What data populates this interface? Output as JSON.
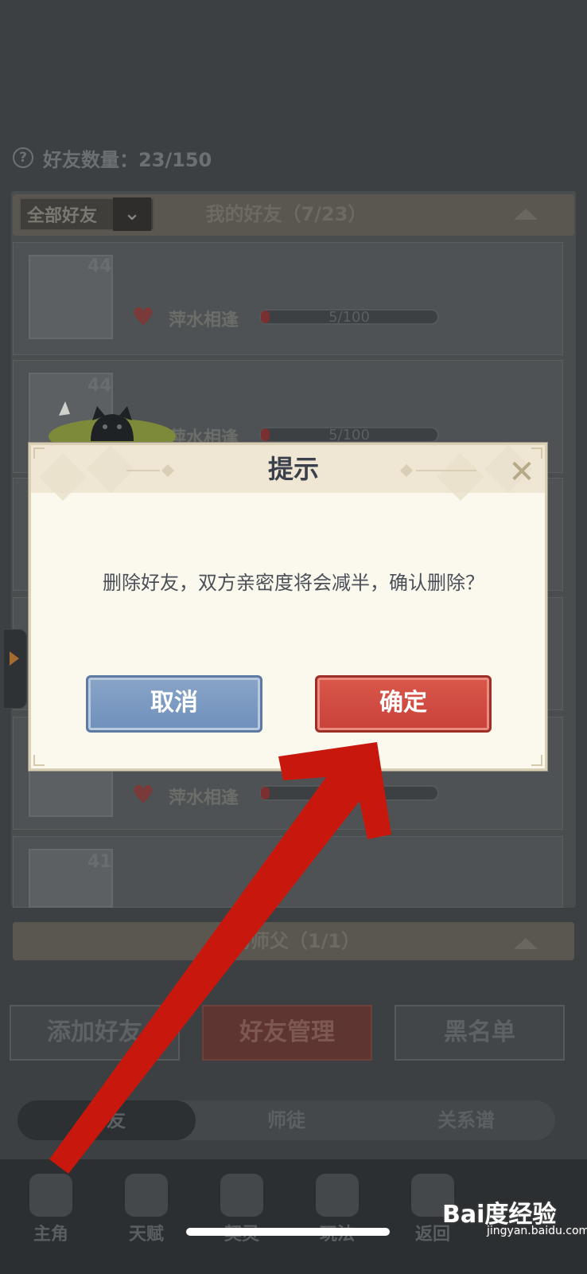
{
  "background": {
    "friend_count": "好友数量：23/150",
    "filter_value": "全部好友",
    "list_title": "我的好友（7/23）",
    "rows": [
      {
        "level": "44",
        "heart": "1",
        "relation": "萍水相逢",
        "progress_text": "5/100",
        "progress": 0.05
      },
      {
        "level": "44",
        "heart": "1",
        "relation": "萍水相逢",
        "progress_text": "5/100",
        "progress": 0.05
      },
      {
        "level": "",
        "heart": "1",
        "relation": "萍水相逢",
        "progress_text": "",
        "progress": 0.05
      },
      {
        "level": "41",
        "heart": "",
        "relation": "",
        "progress_text": "",
        "progress": 0.05
      }
    ],
    "master_title": "我的师父（1/1）",
    "actions": [
      "添加好友",
      "好友管理",
      "黑名单"
    ],
    "segments": [
      "好友",
      "师徒",
      "关系谱"
    ],
    "nav": [
      "主角",
      "天赋",
      "契灵",
      "玩法",
      "返回"
    ]
  },
  "dialog": {
    "title": "提示",
    "message": "删除好友，双方亲密度将会减半，确认删除？",
    "cancel_label": "取消",
    "confirm_label": "确定",
    "close_icon": "close-x-icon"
  },
  "watermark": {
    "logo": "Bai度经验",
    "url": "jingyan.baidu.com"
  },
  "annotation": {
    "color": "#c8180e"
  }
}
